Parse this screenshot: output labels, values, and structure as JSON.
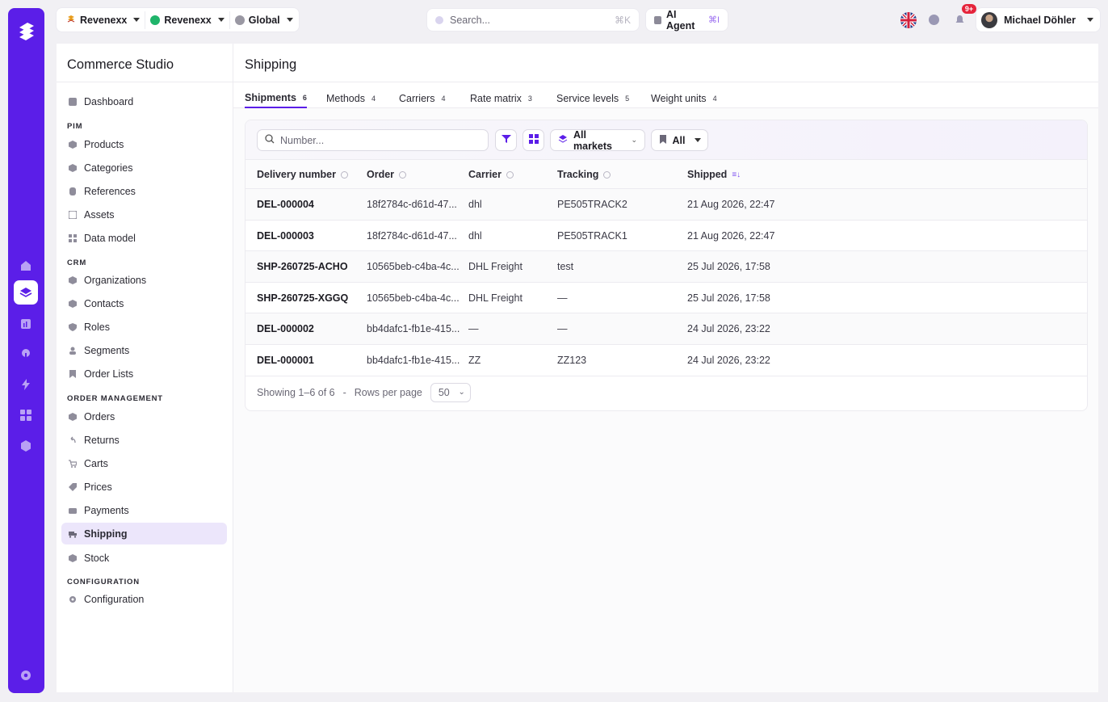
{
  "colors": {
    "brand": "#5b1ee8",
    "active_nav_bg": "#ece6fb",
    "notif": "#e5243b"
  },
  "topbar": {
    "contexts": [
      {
        "label": "Revenexx",
        "icon": "revenexx-logo-icon"
      },
      {
        "label": "Revenexx",
        "icon": "green-dot-icon"
      },
      {
        "label": "Global",
        "icon": "globe-icon"
      }
    ],
    "search": {
      "placeholder": "Search...",
      "shortcut": "⌘K"
    },
    "ai_agent": {
      "label": "AI Agent",
      "shortcut": "⌘I"
    },
    "notifications_badge": "9+",
    "user_name": "Michael Döhler"
  },
  "sidebar": {
    "title": "Commerce Studio",
    "sections": {
      "pim": "PIM",
      "crm": "CRM",
      "order_management": "ORDER MANAGEMENT",
      "configuration": "CONFIGURATION"
    },
    "items": {
      "dashboard": "Dashboard",
      "products": "Products",
      "categories": "Categories",
      "references": "References",
      "assets": "Assets",
      "data_model": "Data model",
      "organizations": "Organizations",
      "contacts": "Contacts",
      "roles": "Roles",
      "segments": "Segments",
      "order_lists": "Order Lists",
      "orders": "Orders",
      "returns": "Returns",
      "carts": "Carts",
      "prices": "Prices",
      "payments": "Payments",
      "shipping": "Shipping",
      "stock": "Stock",
      "configuration": "Configuration"
    }
  },
  "main": {
    "title": "Shipping",
    "tabs": [
      {
        "label": "Shipments",
        "count": "6"
      },
      {
        "label": "Methods",
        "count": "4"
      },
      {
        "label": "Carriers",
        "count": "4"
      },
      {
        "label": "Rate matrix",
        "count": "3"
      },
      {
        "label": "Service levels",
        "count": "5"
      },
      {
        "label": "Weight units",
        "count": "4"
      }
    ],
    "toolbar": {
      "number_placeholder": "Number...",
      "markets_label": "All markets",
      "status_label": "All"
    },
    "table": {
      "headers": [
        "Delivery number",
        "Order",
        "Carrier",
        "Tracking",
        "Shipped"
      ],
      "rows": [
        [
          "DEL-000004",
          "18f2784c-d61d-47...",
          "dhl",
          "PE505TRACK2",
          "21 Aug 2026, 22:47"
        ],
        [
          "DEL-000003",
          "18f2784c-d61d-47...",
          "dhl",
          "PE505TRACK1",
          "21 Aug 2026, 22:47"
        ],
        [
          "SHP-260725-ACHO",
          "10565beb-c4ba-4c...",
          "DHL Freight",
          "test",
          "25 Jul 2026, 17:58"
        ],
        [
          "SHP-260725-XGGQ",
          "10565beb-c4ba-4c...",
          "DHL Freight",
          "—",
          "25 Jul 2026, 17:58"
        ],
        [
          "DEL-000002",
          "bb4dafc1-fb1e-415...",
          "—",
          "—",
          "24 Jul 2026, 23:22"
        ],
        [
          "DEL-000001",
          "bb4dafc1-fb1e-415...",
          "ZZ",
          "ZZ123",
          "24 Jul 2026, 23:22"
        ]
      ]
    },
    "footer": {
      "showing": "Showing 1–6 of 6",
      "sep": "-",
      "rows_per_page_label": "Rows per page",
      "rows_per_page_value": "50"
    }
  }
}
